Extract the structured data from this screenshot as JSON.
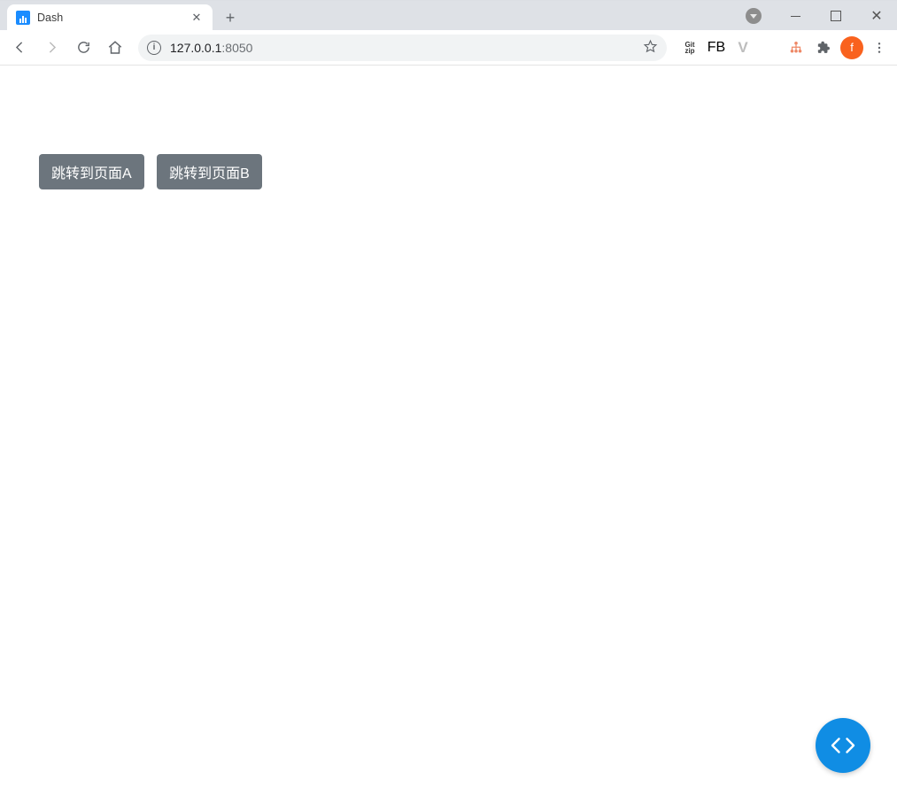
{
  "window": {
    "tab_title": "Dash",
    "url_host": "127.0.0.1",
    "url_port": ":8050"
  },
  "toolbar": {
    "gitzip_label": "Git\nzip",
    "fb_label": "FB",
    "vue_label": "V",
    "avatar_initial": "f"
  },
  "app": {
    "button_a": "跳转到页面A",
    "button_b": "跳转到页面B"
  }
}
